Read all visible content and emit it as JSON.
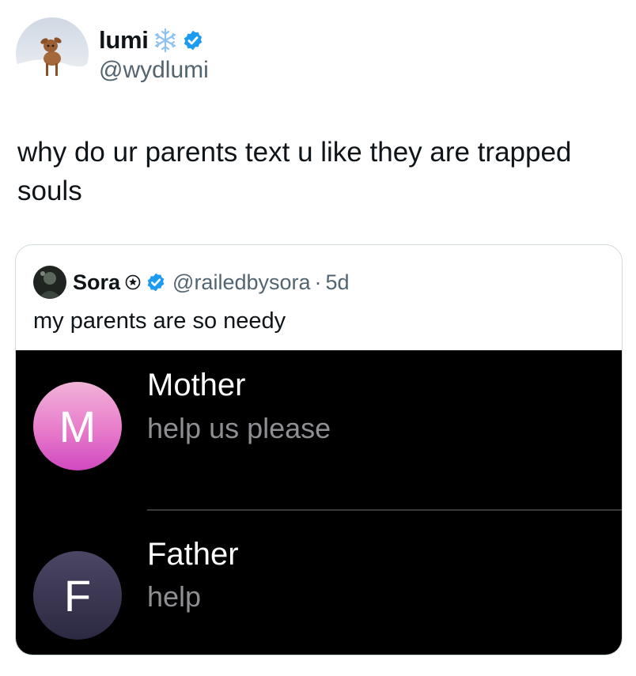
{
  "author": {
    "name": "lumi",
    "handle": "@wydlumi"
  },
  "tweet": {
    "text": "why do ur parents text u like they are trapped souls"
  },
  "quote": {
    "name": "Sora",
    "handle": "@railedbysora",
    "separator": "·",
    "time": "5d",
    "text": "my parents are so needy"
  },
  "contacts": [
    {
      "initial": "M",
      "name": "Mother",
      "message": "help us please"
    },
    {
      "initial": "F",
      "name": "Father",
      "message": "help"
    }
  ],
  "colors": {
    "verified": "#1d9bf0",
    "mother_avatar": "#e07ccb",
    "father_avatar": "#3b3752",
    "media_bg": "#000000",
    "secondary_text": "#536471"
  }
}
